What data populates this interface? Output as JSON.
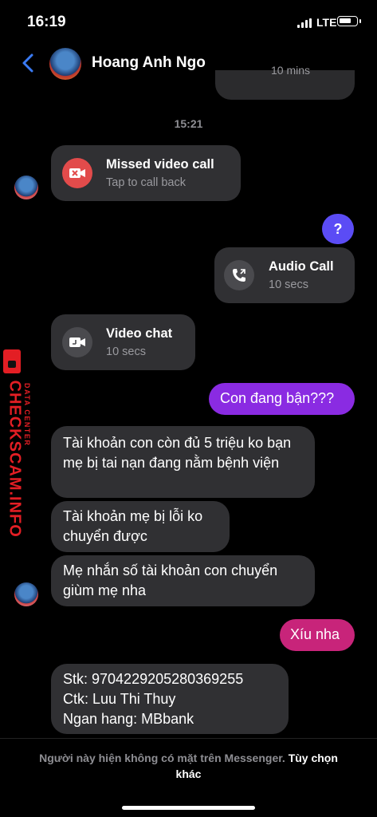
{
  "status_bar": {
    "time": "16:19",
    "network": "LTE"
  },
  "header": {
    "contact_name": "Hoang Anh Ngo"
  },
  "top_card_partial": "10 mins",
  "timestamp": "15:21",
  "missed_call": {
    "title": "Missed video call",
    "subtitle": "Tap to call back"
  },
  "sent_question": "?",
  "audio_call": {
    "title": "Audio Call",
    "subtitle": "10 secs"
  },
  "video_chat": {
    "title": "Video chat",
    "subtitle": "10 secs"
  },
  "sent_busy": "Con đang bận???",
  "messages_in_1": [
    "Tài khoản con còn đủ 5 triệu ko bạn mẹ bị tai nạn đang nằm bệnh viện",
    "Tài khoản mẹ bị lỗi ko chuyển được",
    "Mẹ nhắn số tài khoản con chuyển giùm mẹ nha"
  ],
  "sent_wait": "Xíu nha",
  "account_message": {
    "line1": "Stk: 9704229205280369255",
    "line2": "Ctk: Luu Thi Thuy",
    "line3": "Ngan hang: MBbank"
  },
  "watermark": {
    "brand": "CHECKSCAM.INFO",
    "tagline": "DATA CENTER"
  },
  "footer": {
    "notice": "Người này hiện không có mặt trên Messenger.",
    "link": "Tùy chọn khác"
  },
  "colors": {
    "accent_blue": "#5b4cf5",
    "accent_purple": "#8a2be2",
    "accent_pink": "#c8247a",
    "missed_red": "#e24b4b",
    "watermark_red": "#e31e24"
  }
}
